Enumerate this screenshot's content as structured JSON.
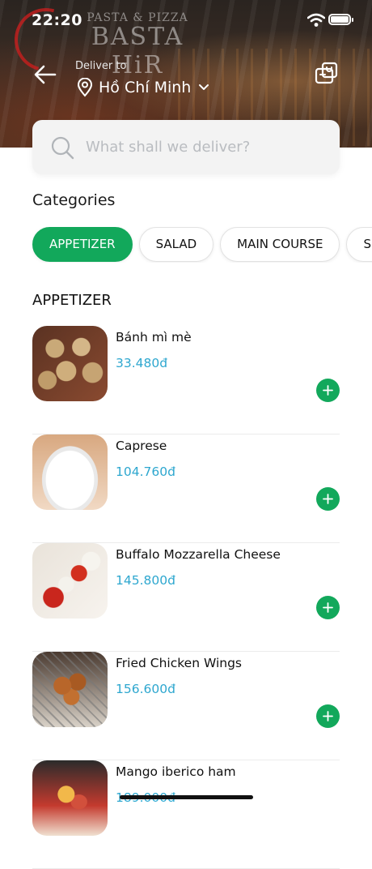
{
  "status_bar": {
    "time": "22:20"
  },
  "header": {
    "deliver_label": "Deliver to",
    "location": "Hồ Chí Minh",
    "banner_sign_top": "PASTA & PIZZA",
    "banner_sign_main": "BASTA HiR"
  },
  "search": {
    "placeholder": "What shall we deliver?",
    "value": ""
  },
  "categories": {
    "title": "Categories",
    "chips": [
      {
        "label": "APPETIZER",
        "active": true
      },
      {
        "label": "SALAD",
        "active": false
      },
      {
        "label": "MAIN COURSE",
        "active": false
      },
      {
        "label": "S",
        "active": false
      }
    ]
  },
  "section": {
    "title": "APPETIZER"
  },
  "products": [
    {
      "name": "Bánh mì mè",
      "price": "33.480đ",
      "image_icon": "bread-image"
    },
    {
      "name": "Caprese",
      "price": "104.760đ",
      "image_icon": "salad-image"
    },
    {
      "name": "Buffalo Mozzarella Cheese",
      "price": "145.800đ",
      "image_icon": "mozzarella-image"
    },
    {
      "name": "Fried Chicken Wings",
      "price": "156.600đ",
      "image_icon": "chicken-wings-image"
    },
    {
      "name": "Mango iberico ham",
      "price": "189.000đ",
      "image_icon": "ham-image"
    }
  ],
  "colors": {
    "accent": "#12a85b",
    "price": "#2ea7cf"
  }
}
